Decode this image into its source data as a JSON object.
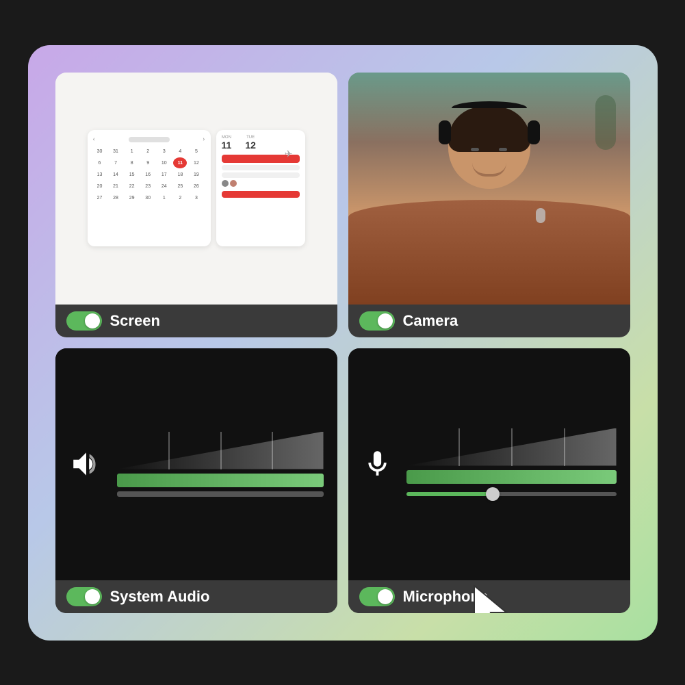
{
  "background": {
    "gradient_start": "#c8a8e8",
    "gradient_end": "#a8e0a0"
  },
  "cards": {
    "screen": {
      "label": "Screen",
      "toggle_on": true,
      "calendar": {
        "days": [
          "30",
          "31",
          "1",
          "2",
          "3",
          "4",
          "5",
          "6",
          "7",
          "8",
          "9",
          "10",
          "11",
          "12",
          "13",
          "14",
          "15",
          "16",
          "17",
          "18",
          "19",
          "20",
          "21",
          "22",
          "23",
          "24",
          "25",
          "26",
          "27",
          "28",
          "29",
          "30"
        ],
        "today": "11"
      },
      "schedule": {
        "day1_label": "MON",
        "day1_num": "11",
        "day2_label": "TUE",
        "day2_num": "12"
      }
    },
    "camera": {
      "label": "Camera",
      "toggle_on": true
    },
    "system_audio": {
      "label": "System Audio",
      "toggle_on": true,
      "level_pct": 55
    },
    "microphone": {
      "label": "Microphone",
      "toggle_on": true,
      "level_pct": 60,
      "slider_pct": 38
    }
  },
  "colors": {
    "toggle_on": "#5cb85c",
    "toggle_knob": "#ffffff",
    "bar_green": "#5cb85c",
    "bar_dark": "#3a3a3a",
    "card_dark_bg": "#111111",
    "card_light_bg": "#f0eeec",
    "text_white": "#ffffff",
    "calendar_today": "#e53935"
  }
}
